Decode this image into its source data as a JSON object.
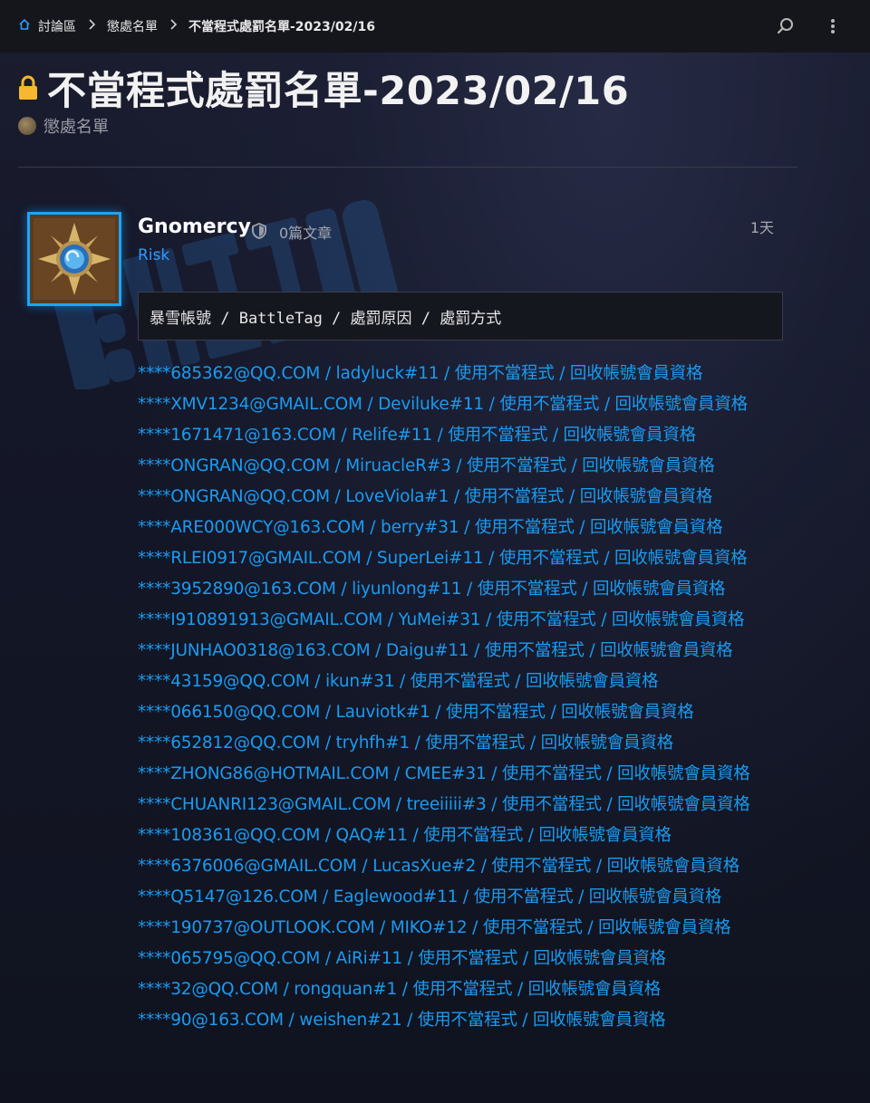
{
  "breadcrumb": {
    "home_icon": "home-icon",
    "items": [
      "討論區",
      "懲處名單",
      "不當程式處罰名單-2023/02/16"
    ]
  },
  "topbar": {
    "search_icon": "search-icon",
    "menu_icon": "more-vertical-icon"
  },
  "topic": {
    "title": "不當程式處罰名單-2023/02/16",
    "locked": true,
    "category": "懲處名單"
  },
  "post": {
    "username": "Gnomercy",
    "post_count": "0篇文章",
    "user_title": "Risk",
    "time": "1天",
    "header_line": "暴雪帳號 / BattleTag / 處罰原因 / 處罰方式",
    "entries": [
      "****685362@QQ.COM / ladyluck#11 / 使用不當程式 / 回收帳號會員資格",
      "****XMV1234@GMAIL.COM / Deviluke#11 / 使用不當程式 / 回收帳號會員資格",
      "****1671471@163.COM / Relife#11 / 使用不當程式 / 回收帳號會員資格",
      "****ONGRAN@QQ.COM / MiruacleR#3 / 使用不當程式 / 回收帳號會員資格",
      "****ONGRAN@QQ.COM / LoveViola#1 / 使用不當程式 / 回收帳號會員資格",
      "****ARE000WCY@163.COM / berry#31 / 使用不當程式 / 回收帳號會員資格",
      "****RLEI0917@GMAIL.COM / SuperLei#11 / 使用不當程式 / 回收帳號會員資格",
      "****3952890@163.COM / liyunlong#11 / 使用不當程式 / 回收帳號會員資格",
      "****I910891913@GMAIL.COM / YuMei#31 / 使用不當程式 / 回收帳號會員資格",
      "****JUNHAO0318@163.COM / Daigu#11 / 使用不當程式 / 回收帳號會員資格",
      "****43159@QQ.COM / ikun#31 / 使用不當程式 / 回收帳號會員資格",
      "****066150@QQ.COM / Lauviotk#1 / 使用不當程式 / 回收帳號會員資格",
      "****652812@QQ.COM / tryhfh#1 / 使用不當程式 / 回收帳號會員資格",
      "****ZHONG86@HOTMAIL.COM / CMEE#31 / 使用不當程式 / 回收帳號會員資格",
      "****CHUANRI123@GMAIL.COM / treeiiiii#3 / 使用不當程式 / 回收帳號會員資格",
      "****108361@QQ.COM / QAQ#11 / 使用不當程式 / 回收帳號會員資格",
      "****6376006@GMAIL.COM / LucasXue#2 / 使用不當程式 / 回收帳號會員資格",
      "****Q5147@126.COM / Eaglewood#11 / 使用不當程式 / 回收帳號會員資格",
      "****190737@OUTLOOK.COM / MIKO#12 / 使用不當程式 / 回收帳號會員資格",
      "****065795@QQ.COM / AiRi#11 / 使用不當程式 / 回收帳號會員資格",
      "****32@QQ.COM / rongquan#1 / 使用不當程式 / 回收帳號會員資格",
      "****90@163.COM / weishen#21 / 使用不當程式 / 回收帳號會員資格"
    ]
  },
  "colors": {
    "accent": "#1a9bf0",
    "lock": "#f5b82e",
    "avatar_border": "#1aa6ff"
  }
}
